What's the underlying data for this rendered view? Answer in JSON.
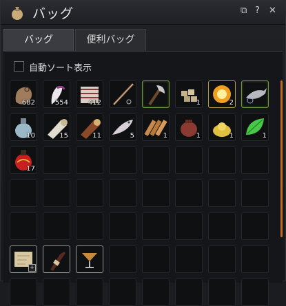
{
  "window": {
    "title": "バッグ"
  },
  "titlebar_buttons": {
    "copy": "⧉",
    "help": "?",
    "close": "✕"
  },
  "tabs": [
    {
      "label": "バッグ"
    },
    {
      "label": "便利バッグ"
    }
  ],
  "sort": {
    "label": "自動ソート表示",
    "checked": false
  },
  "slots": [
    {
      "icon": "hide-bundle-icon",
      "qty": "682"
    },
    {
      "icon": "feather-icon",
      "qty": "554"
    },
    {
      "icon": "leather-stack-icon",
      "qty": "412"
    },
    {
      "icon": "fishing-rod-icon",
      "qty": ""
    },
    {
      "icon": "axe-icon",
      "qty": "",
      "border": "rare"
    },
    {
      "icon": "ore-chunks-icon",
      "qty": "1"
    },
    {
      "icon": "spark-ore-icon",
      "qty": "2",
      "border": "gold"
    },
    {
      "icon": "fish-icon",
      "qty": "",
      "border": "rare"
    },
    {
      "icon": "water-flask-icon",
      "qty": "10"
    },
    {
      "icon": "white-log-icon",
      "qty": "15"
    },
    {
      "icon": "brown-log-icon",
      "qty": "11"
    },
    {
      "icon": "small-fish-icon",
      "qty": "5"
    },
    {
      "icon": "timber-bundle-icon",
      "qty": "1"
    },
    {
      "icon": "clay-pot-icon",
      "qty": "1"
    },
    {
      "icon": "gold-dust-icon",
      "qty": "1"
    },
    {
      "icon": "green-leaf-icon",
      "qty": "1"
    },
    {
      "icon": "red-potion-icon",
      "qty": "17"
    },
    {},
    {},
    {},
    {},
    {},
    {},
    {},
    {},
    {},
    {},
    {},
    {},
    {},
    {},
    {},
    {},
    {},
    {},
    {},
    {},
    {},
    {},
    {},
    {
      "icon": "map-scroll-icon",
      "qty": "",
      "border": "white",
      "plus": "+"
    },
    {
      "icon": "wine-bottle-icon",
      "qty": "",
      "border": "white"
    },
    {
      "icon": "cocktail-glass-icon",
      "qty": "",
      "border": "white"
    },
    {},
    {},
    {},
    {},
    {},
    {},
    {},
    {},
    {},
    {},
    {},
    {},
    {}
  ]
}
